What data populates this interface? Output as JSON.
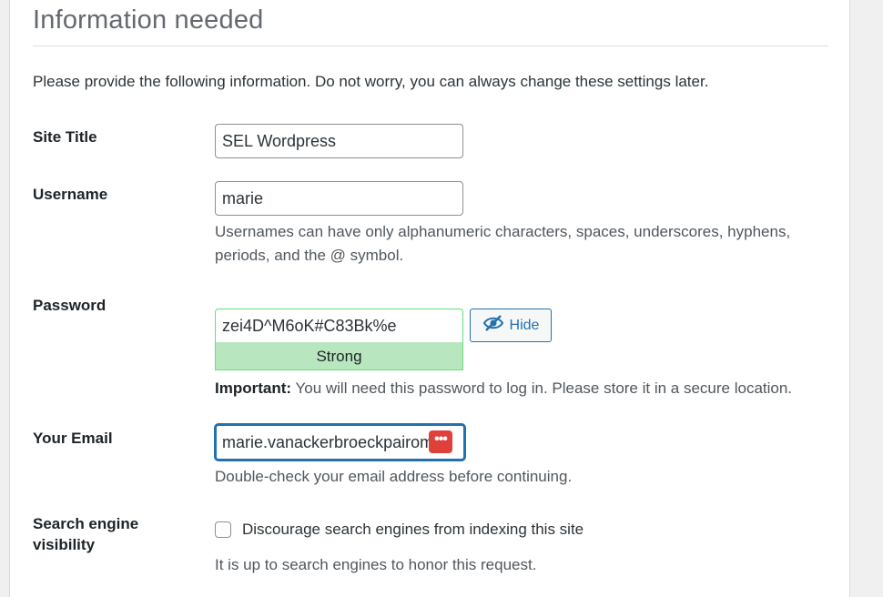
{
  "section": {
    "heading": "Information needed",
    "intro": "Please provide the following information. Do not worry, you can always change these settings later."
  },
  "site_title": {
    "label": "Site Title",
    "value": "SEL Wordpress"
  },
  "username": {
    "label": "Username",
    "value": "marie",
    "help_line1": "Usernames can have only alphanumeric characters, spaces, underscores, hyphens,",
    "help_line2": "periods, and the @ symbol."
  },
  "password": {
    "label": "Password",
    "value": "zei4D^M6oK#C83Bk%e",
    "strength": "Strong",
    "hide_label": "Hide",
    "important_prefix": "Important:",
    "important_text": " You will need this password to log in. Please store it in a secure location."
  },
  "email": {
    "label": "Your Email",
    "value": "marie.vanackerbroeckpairomes",
    "badge": "•••",
    "help": "Double-check your email address before continuing."
  },
  "search_visibility": {
    "label_line1": "Search engine",
    "label_line2": "visibility",
    "checkbox_label": "Discourage search engines from indexing this site",
    "checked": false,
    "note": "It is up to search engines to honor this request."
  },
  "colors": {
    "accent": "#2271b1",
    "strength_bg": "#b8e6bf",
    "badge": "#e0403a"
  },
  "icons": {
    "hide": "eye-slash-icon"
  }
}
